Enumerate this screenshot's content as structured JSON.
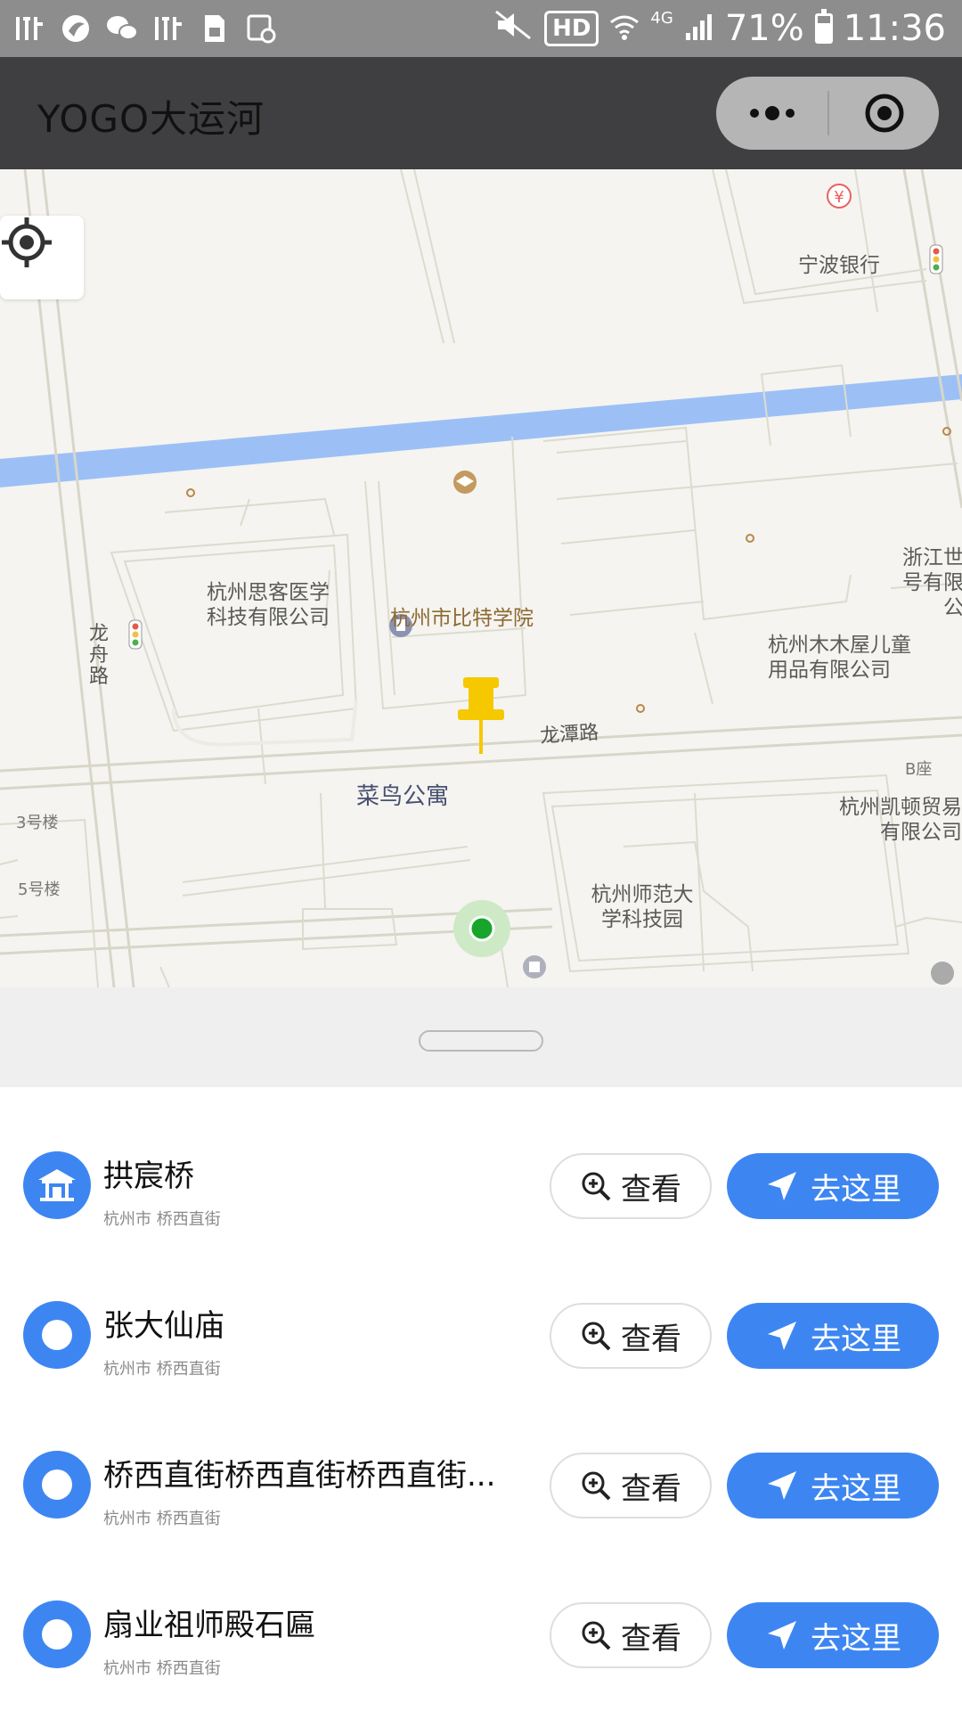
{
  "status_bar": {
    "left_icons": [
      "listen-app-icon",
      "browser-icon",
      "wechat-icon",
      "listen-app-icon",
      "sim-icon",
      "gallery-icon"
    ],
    "hd": "HD",
    "network": "4G",
    "battery": "71%",
    "time": "11:36"
  },
  "title_bar": {
    "title": "YOGO大运河"
  },
  "map": {
    "labels": {
      "ningbo_bank": "宁波银行",
      "sike": "杭州思客医学科技有限公司",
      "bite": "杭州市比特学院",
      "zhejiang_shi": "浙江世号有限公",
      "mumuwu": "杭州木木屋儿童用品有限公司",
      "longtan_road": "龙潭路",
      "longzhou_road": "龙舟路",
      "cainiao": "菜鸟公寓",
      "kaidun": "杭州凯顿贸易有限公司",
      "b_zuo": "B座",
      "building3": "3号楼",
      "building5": "5号楼",
      "normal_univ": "杭州师范大学科技园"
    }
  },
  "list": {
    "items": [
      {
        "name": "拱宸桥",
        "address": "杭州市 桥西直街",
        "icon": "pavilion-icon"
      },
      {
        "name": "张大仙庙",
        "address": "杭州市 桥西直街",
        "icon": "dot-icon"
      },
      {
        "name": "桥西直街桥西直街桥西直街...",
        "address": "杭州市 桥西直街",
        "icon": "dot-icon"
      },
      {
        "name": "扇业祖师殿石匾",
        "address": "杭州市 桥西直街",
        "icon": "dot-icon"
      }
    ],
    "view_label": "查看",
    "go_label": "去这里"
  },
  "colors": {
    "accent": "#3d86f2",
    "river": "#9cc0f6",
    "title_bar": "#3f3f41"
  }
}
